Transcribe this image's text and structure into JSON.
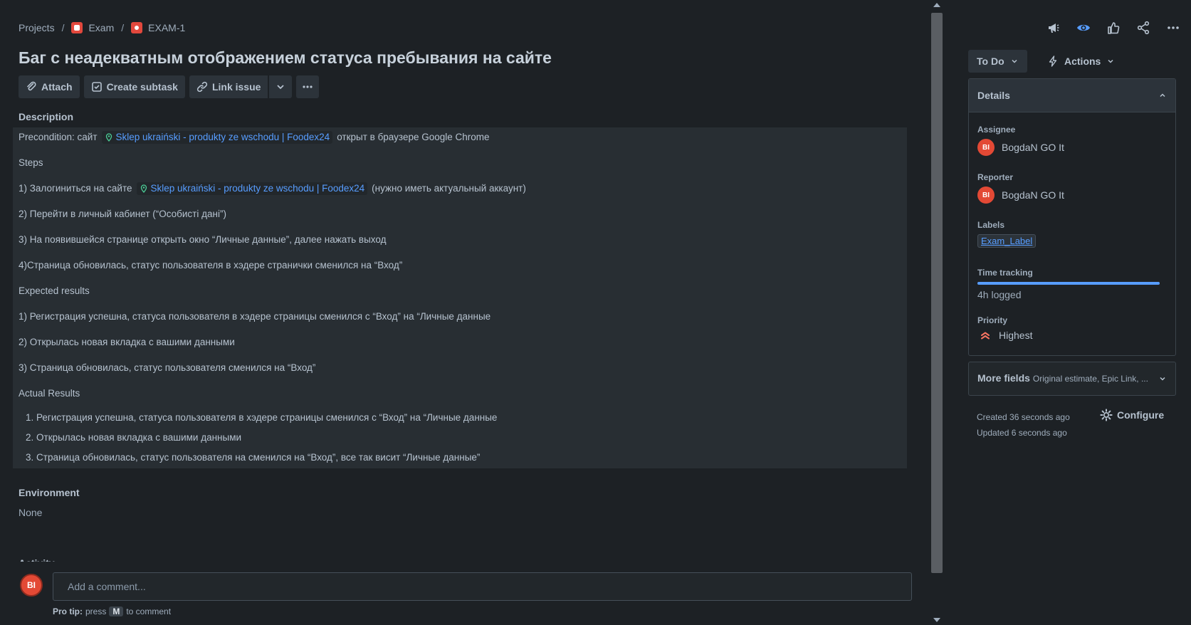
{
  "breadcrumb": {
    "projects": "Projects",
    "project": "Exam",
    "issue_key": "EXAM-1",
    "separator": "/"
  },
  "issue": {
    "title": "Баг с неадекватным отображением статуса пребывания на сайте"
  },
  "toolbar": {
    "attach": "Attach",
    "create_subtask": "Create subtask",
    "link_issue": "Link issue"
  },
  "description": {
    "label": "Description",
    "precondition_prefix": "Precondition:  сайт",
    "link_text": "Sklep ukraiński - produkty ze wschodu | Foodex24",
    "precondition_suffix": "открыт в браузере Google Chrome",
    "steps_heading": "Steps",
    "step1_prefix": "1) Залогиниться на сайте",
    "step1_suffix": "(нужно иметь актуальный аккаунт)",
    "step2": "2)  Перейти в личный кабинет (“Особисті дані”)",
    "step3": "3)  На появившейся странице открыть окно “Личные данные”, далее нажать выход",
    "step4": "4)Страница обновилась, статус пользователя в хэдере странички сменился на “Вход”",
    "expected_heading": "Expected results",
    "expected1": "1) Регистрация успешна, статуса пользователя в хэдере страницы сменился с “Вход” на “Личные данные",
    "expected2": "2) Открылась новая вкладка с вашими данными",
    "expected3": "3) Страница обновилась, статус пользователя сменился на “Вход”",
    "actual_heading": "Actual Results",
    "actual1": "1.  Регистрация успешна, статуса пользователя в хэдере страницы сменился с “Вход” на “Личные данные",
    "actual2": "2. Открылась новая вкладка с вашими данными",
    "actual3": "3. Страница обновилась, статус пользователя на сменился на “Вход”, все так висит “Личные данные”"
  },
  "environment": {
    "label": "Environment",
    "value": "None"
  },
  "activity": {
    "label": "Activity"
  },
  "comment": {
    "avatar_initials": "BI",
    "placeholder": "Add a comment...",
    "pro_tip_label": "Pro tip:",
    "pro_tip_press": "press",
    "pro_tip_key": "M",
    "pro_tip_suffix": "to comment"
  },
  "sidebar": {
    "status": "To Do",
    "actions": "Actions",
    "details_heading": "Details",
    "assignee_label": "Assignee",
    "assignee_initials": "BI",
    "assignee_name": "BogdaN GO It",
    "reporter_label": "Reporter",
    "reporter_initials": "BI",
    "reporter_name": "BogdaN GO It",
    "labels_label": "Labels",
    "label_value": "Exam_Label",
    "time_label": "Time tracking",
    "time_logged": "4h logged",
    "time_fill_fraction": 1.0,
    "priority_label": "Priority",
    "priority_value": "Highest",
    "more_fields": "More fields",
    "more_fields_sub": "Original estimate, Epic Link, ...",
    "created": "Created 36 seconds ago",
    "updated": "Updated 6 seconds ago",
    "configure": "Configure"
  },
  "colors": {
    "background": "#1d2125",
    "link": "#579dff",
    "priority": "#f87462",
    "avatar": "#e34935"
  }
}
